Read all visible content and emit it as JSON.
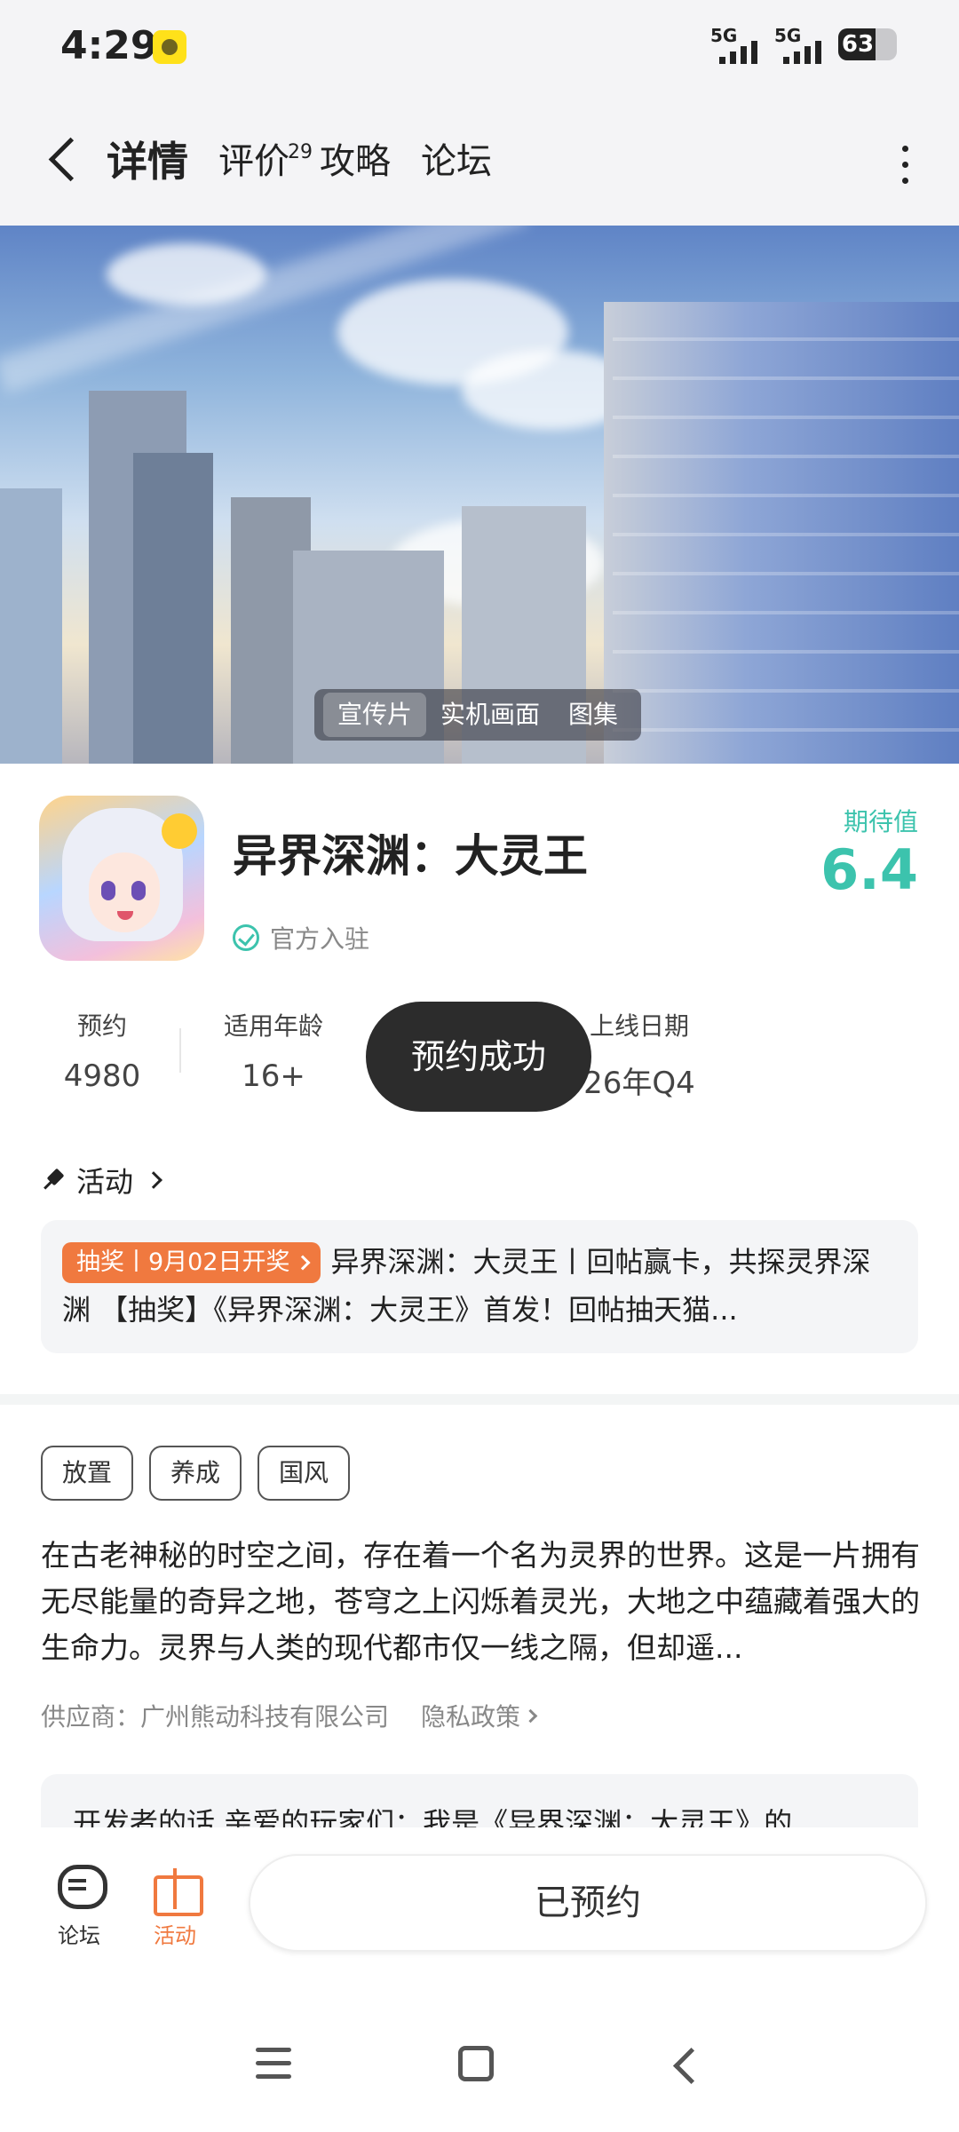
{
  "status_bar": {
    "time": "4:29",
    "network1": "5G",
    "network2": "5G",
    "battery_percent": 63
  },
  "header": {
    "tabs": [
      {
        "label": "详情",
        "active": true
      },
      {
        "label": "评价",
        "badge": "29"
      },
      {
        "label": "攻略"
      },
      {
        "label": "论坛"
      }
    ]
  },
  "hero": {
    "switch": [
      "宣传片",
      "实机画面",
      "图集"
    ]
  },
  "game": {
    "title": "异界深渊：大灵王",
    "verified": "官方入驻",
    "expect_label": "期待值",
    "expect_value": "6.4",
    "accent_color": "#3cc3ad"
  },
  "stats": {
    "reserve_label": "预约",
    "reserve_value": "4980",
    "age_label": "适用年龄",
    "age_value": "16+",
    "date_label": "上线日期",
    "date_value": "26年Q4"
  },
  "toast": "预约成功",
  "activity": {
    "title": "活动",
    "tag": "抽奖丨9月02日开奖",
    "text": "异界深渊：大灵王丨回帖赢卡，共探灵界深渊 【抽奖】《异界深渊：大灵王》首发！回帖抽天猫...",
    "tag_color": "#f0793f"
  },
  "tags": [
    "放置",
    "养成",
    "国风"
  ],
  "description": "在古老神秘的时空之间，存在着一个名为灵界的世界。这是一片拥有无尽能量的奇异之地，苍穹之上闪烁着灵光，大地之中蕴藏着强大的生命力。灵界与人类的现代都市仅一线之隔，但却遥...",
  "supplier": "供应商：广州熊动科技有限公司",
  "privacy": "隐私政策",
  "developer_note": "开发者的话  亲爱的玩家们：我是《异界深渊：大灵王》的",
  "bottom_bar": {
    "forum": "论坛",
    "activity": "活动",
    "reserved": "已预约"
  }
}
